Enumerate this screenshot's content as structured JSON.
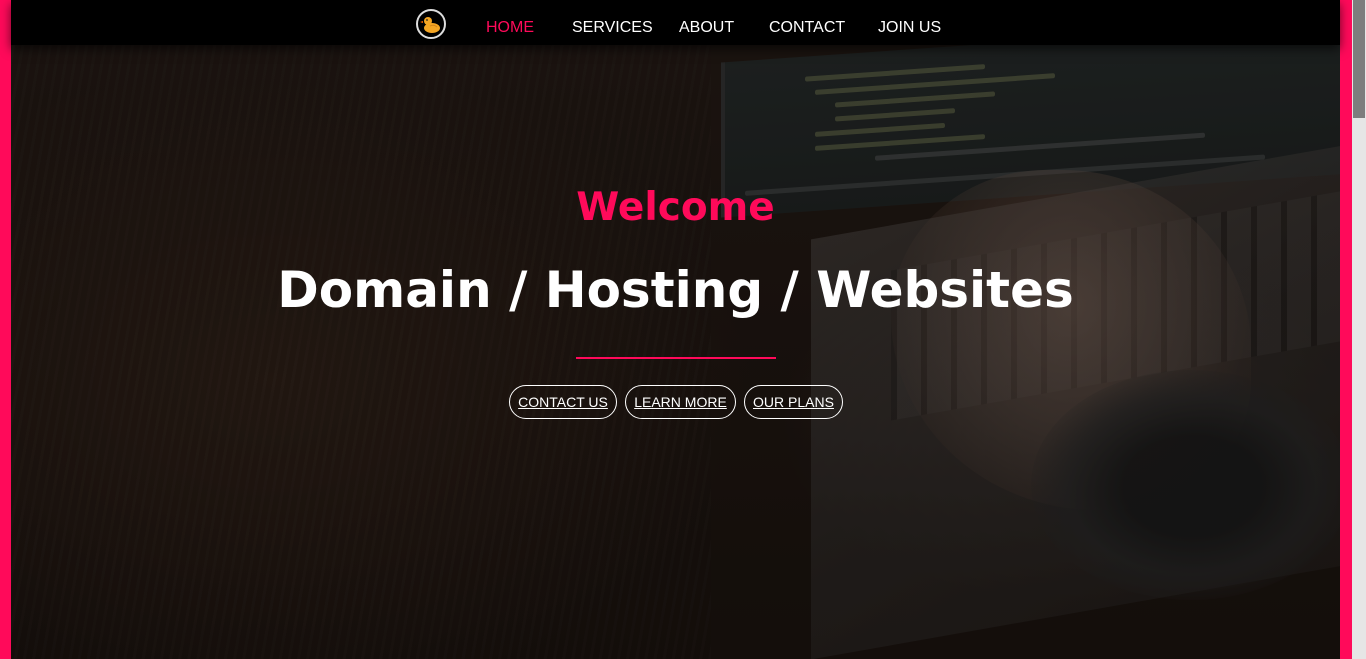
{
  "nav": {
    "logo_icon": "duck-icon",
    "links": [
      {
        "label": "HOME",
        "active": true
      },
      {
        "label": "SERVICES",
        "active": false
      },
      {
        "label": "ABOUT",
        "active": false
      },
      {
        "label": "CONTACT",
        "active": false
      },
      {
        "label": "JOIN US",
        "active": false
      }
    ]
  },
  "hero": {
    "welcome": "Welcome",
    "headline": "Domain / Hosting / Websites",
    "buttons": [
      {
        "label": "CONTACT US"
      },
      {
        "label": "LEARN MORE"
      },
      {
        "label": "OUR PLANS"
      }
    ]
  },
  "colors": {
    "accent": "#ff0a5a",
    "nav_background": "#000000",
    "text": "#ffffff"
  }
}
